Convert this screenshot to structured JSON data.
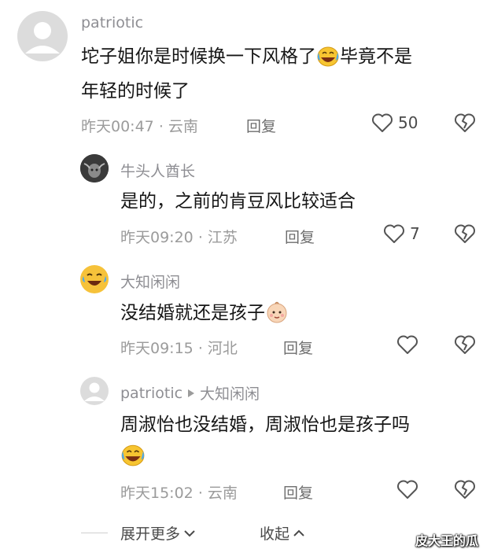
{
  "comments": [
    {
      "username": "patriotic",
      "line1": "坨子姐你是时候换一下风格了",
      "line1b": "毕竟不是",
      "line2": "年轻的时候了",
      "time": "昨天00:47",
      "location": "云南",
      "reply_label": "回复",
      "likes": "50"
    },
    {
      "username": "牛头人酋长",
      "line1": "是的，之前的肯豆风比较适合",
      "time": "昨天09:20",
      "location": "江苏",
      "reply_label": "回复",
      "likes": "7"
    },
    {
      "username": "大知闲闲",
      "line1": "没结婚就还是孩子",
      "time": "昨天09:15",
      "location": "河北",
      "reply_label": "回复",
      "likes": ""
    },
    {
      "username": "patriotic",
      "reply_to": "大知闲闲",
      "line1": "周淑怡也没结婚，周淑怡也是孩子吗",
      "time": "昨天15:02",
      "location": "云南",
      "reply_label": "回复",
      "likes": ""
    }
  ],
  "meta_separator": "·",
  "footer": {
    "expand_label": "展开更多",
    "collapse_label": "收起"
  },
  "watermark": "皮大王的瓜",
  "colors": {
    "text": "#161616",
    "muted": "#9b9b9b",
    "username": "#8e8e93"
  }
}
